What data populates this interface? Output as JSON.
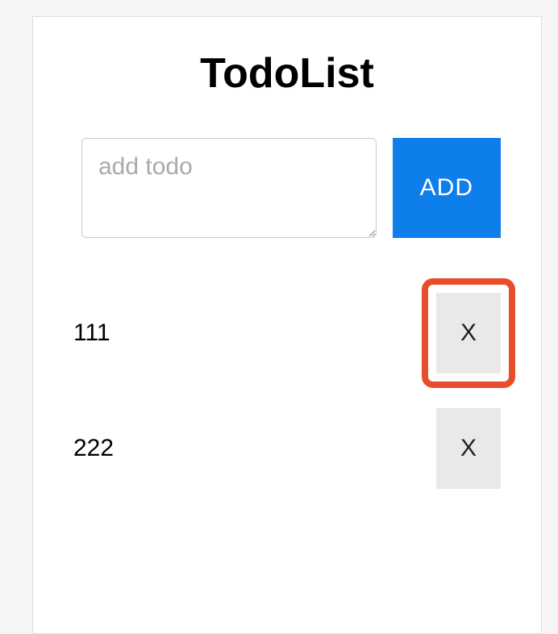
{
  "title": "TodoList",
  "input": {
    "placeholder": "add todo",
    "value": ""
  },
  "add_button_label": "ADD",
  "delete_button_label": "X",
  "todos": [
    {
      "text": "111",
      "highlighted": true
    },
    {
      "text": "222",
      "highlighted": false
    }
  ],
  "colors": {
    "accent": "#0d7eea",
    "highlight_border": "#e84d2b"
  }
}
